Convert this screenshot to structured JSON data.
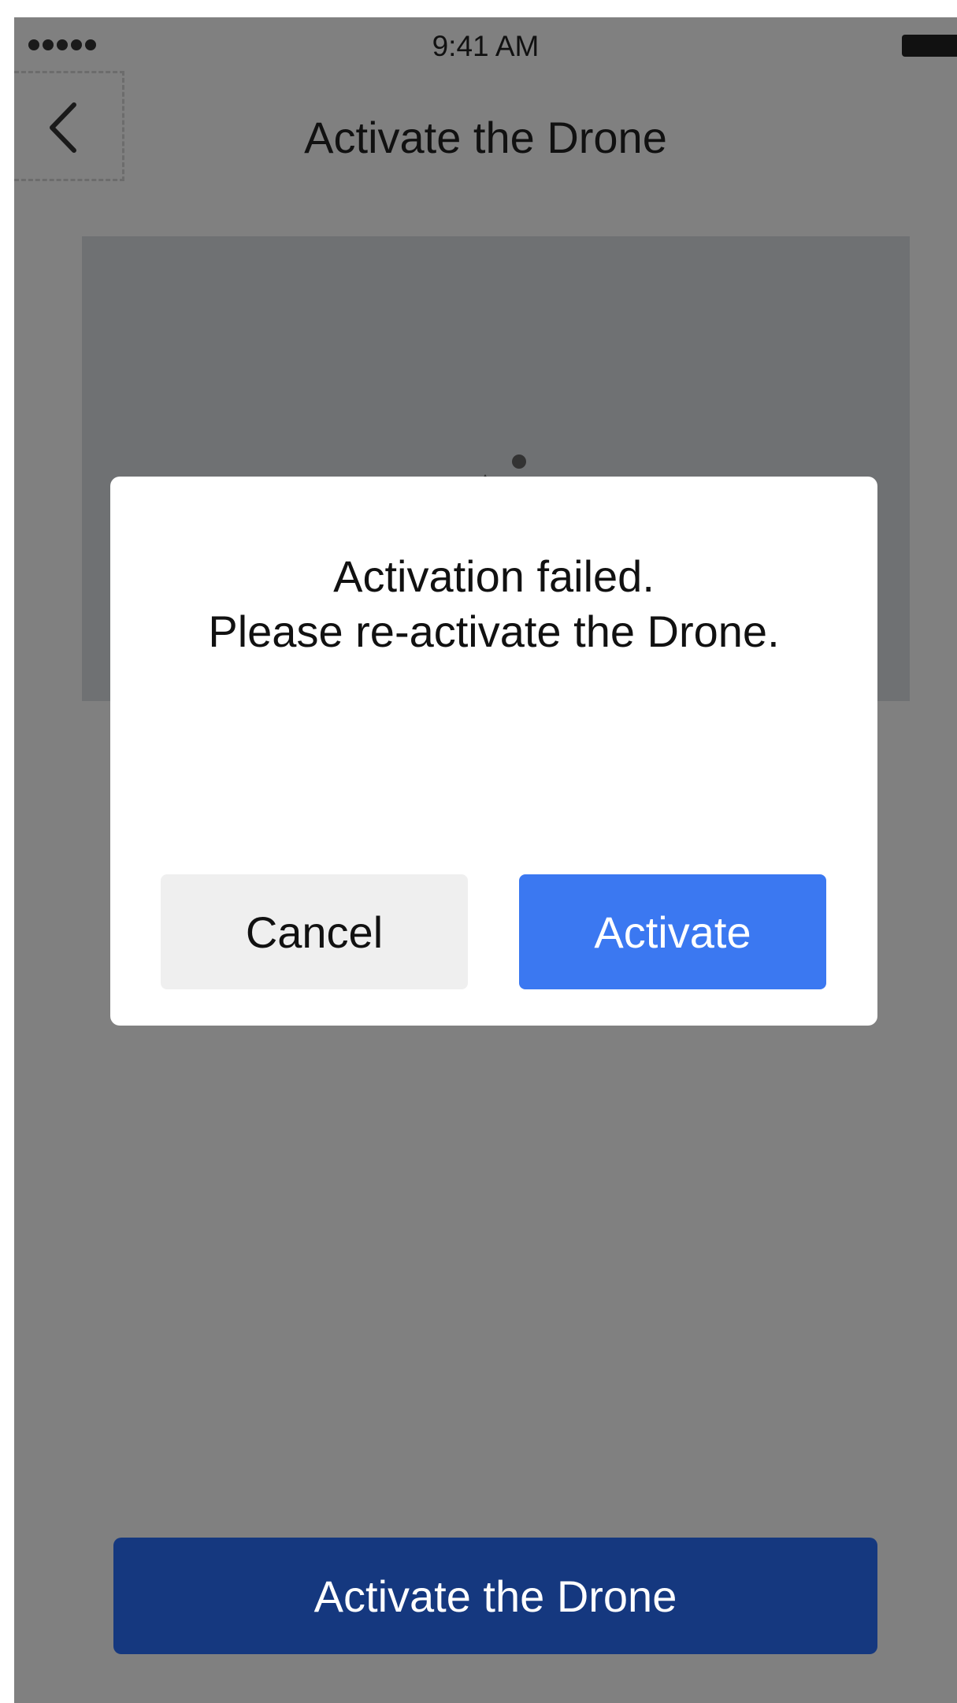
{
  "status_bar": {
    "time": "9:41 AM"
  },
  "nav": {
    "title": "Activate the Drone",
    "back_icon": "chevron-left-icon"
  },
  "dialog": {
    "message_line1": "Activation failed.",
    "message_line2": "Please re-activate the Drone.",
    "cancel_label": "Cancel",
    "activate_label": "Activate"
  },
  "footer": {
    "primary_label": "Activate the Drone"
  },
  "colors": {
    "overlay": "#808080",
    "activate_button": "#3b78f1",
    "primary_button": "#15387f",
    "cancel_button": "#efefef"
  }
}
